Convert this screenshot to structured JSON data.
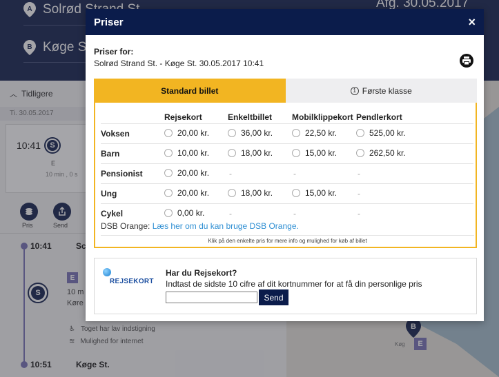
{
  "background": {
    "from_station": "Solrød Strand St",
    "to_station": "Køge S",
    "departure_text": "Afg. 30.05.2017 10:36",
    "earlier_label": "Tidligere",
    "date_label": "Ti. 30.05.2017",
    "card_time": "10:41",
    "card_line": "E",
    "card_duration": "10 min , 0 s",
    "pris_label": "Pris",
    "send_label": "Send",
    "stop1_time": "10:41",
    "stop1_name": "Sc",
    "line_badge": "E",
    "line_text_1": "10 m",
    "line_text_2": "Køre",
    "feature_1": "Toget har lav indstigning",
    "feature_2": "Mulighed for internet",
    "stop2_time": "10:51",
    "stop2_name": "Køge St.",
    "map_marker": "B",
    "map_badge": "E",
    "map_text": "Køg"
  },
  "modal": {
    "title": "Priser",
    "close_symbol": "×",
    "priser_for_label": "Priser for:",
    "route": "Solrød Strand St. - Køge St. 30.05.2017 10:41",
    "tabs": [
      {
        "label": "Standard billet",
        "active": true
      },
      {
        "label": "Første klasse",
        "number": "1",
        "active": false
      }
    ],
    "columns": [
      "",
      "Rejsekort",
      "Enkeltbillet",
      "Mobilklippekort",
      "Pendlerkort"
    ],
    "rows": [
      {
        "category": "Voksen",
        "prices": [
          "20,00 kr.",
          "36,00 kr.",
          "22,50 kr.",
          "525,00 kr."
        ]
      },
      {
        "category": "Barn",
        "prices": [
          "10,00 kr.",
          "18,00 kr.",
          "15,00 kr.",
          "262,50 kr."
        ]
      },
      {
        "category": "Pensionist",
        "prices": [
          "20,00 kr.",
          "-",
          "-",
          "-"
        ]
      },
      {
        "category": "Ung",
        "prices": [
          "20,00 kr.",
          "18,00 kr.",
          "15,00 kr.",
          "-"
        ]
      },
      {
        "category": "Cykel",
        "prices": [
          "0,00 kr.",
          "-",
          "-",
          "-"
        ]
      }
    ],
    "dsb_orange_label": "DSB Orange:",
    "dsb_orange_link": "Læs her om du kan bruge DSB Orange.",
    "info_text": "Klik på den enkelte pris for mere info og mulighed for køb af billet",
    "rejsekort": {
      "logo_text": "REJSEKORT",
      "title": "Har du Rejsekort?",
      "description": "Indtast de sidste 10 cifre af dit kortnummer for at få din personlige pris",
      "input_value": "",
      "input_placeholder": "",
      "send_label": "Send"
    }
  },
  "colors": {
    "header_navy": "#0b1c4b",
    "tab_active": "#f2b522",
    "link_blue": "#2f8fd3",
    "line_purple": "#7d78b8"
  }
}
